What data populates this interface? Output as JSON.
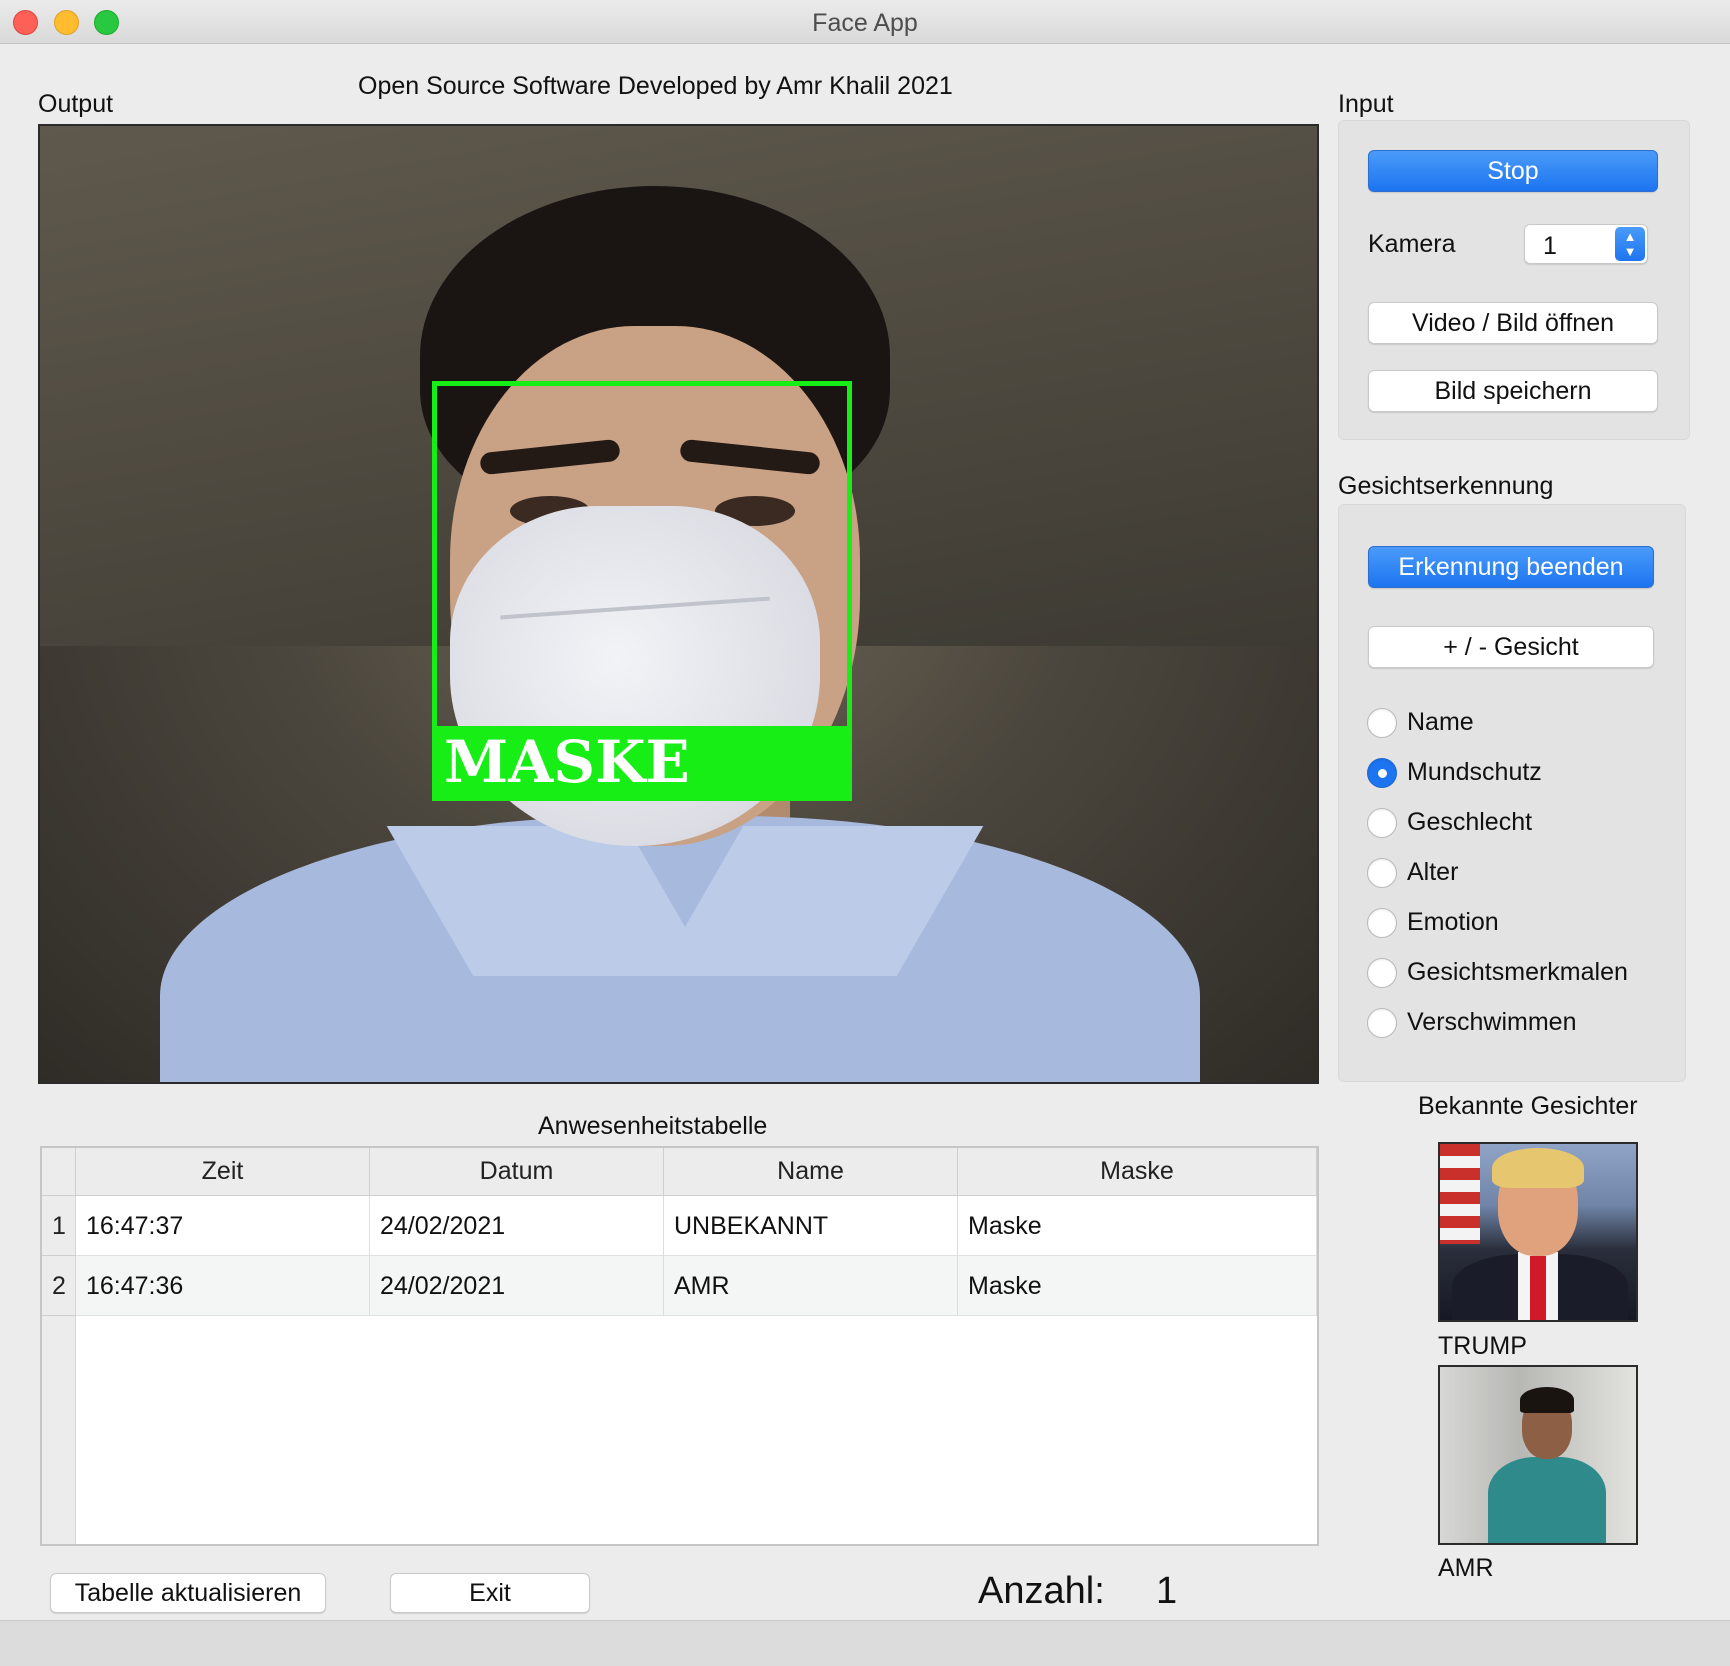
{
  "window": {
    "title": "Face App"
  },
  "header": {
    "credit": "Open Source Software Developed by Amr Khalil 2021"
  },
  "output": {
    "label": "Output",
    "detection_label": "MASKE"
  },
  "input_panel": {
    "label": "Input",
    "stop_button": "Stop",
    "camera_label": "Kamera",
    "camera_value": "1",
    "open_button": "Video / Bild  öffnen",
    "save_button": "Bild speichern"
  },
  "recognition_panel": {
    "label": "Gesichtserkennung",
    "stop_recognition_button": "Erkennung beenden",
    "add_face_button": "+ / - Gesicht",
    "options": [
      {
        "label": "Name",
        "selected": false
      },
      {
        "label": "Mundschutz",
        "selected": true
      },
      {
        "label": "Geschlecht",
        "selected": false
      },
      {
        "label": "Alter",
        "selected": false
      },
      {
        "label": "Emotion",
        "selected": false
      },
      {
        "label": "Gesichtsmerkmalen",
        "selected": false
      },
      {
        "label": "Verschwimmen",
        "selected": false
      }
    ]
  },
  "attendance": {
    "title": "Anwesenheitstabelle",
    "columns": [
      "Zeit",
      "Datum",
      "Name",
      "Maske"
    ],
    "rows": [
      {
        "num": "1",
        "cells": [
          "16:47:37",
          "24/02/2021",
          "UNBEKANNT",
          "Maske"
        ]
      },
      {
        "num": "2",
        "cells": [
          "16:47:36",
          "24/02/2021",
          "AMR",
          "Maske"
        ]
      }
    ]
  },
  "known_faces": {
    "title": "Bekannte Gesichter",
    "faces": [
      {
        "name": "TRUMP"
      },
      {
        "name": "AMR"
      }
    ]
  },
  "footer": {
    "refresh_button": "Tabelle aktualisieren",
    "exit_button": "Exit",
    "count_label": "Anzahl:",
    "count_value": "1"
  },
  "colors": {
    "accent": "#1d74f0",
    "detection_box": "#16ee16"
  }
}
